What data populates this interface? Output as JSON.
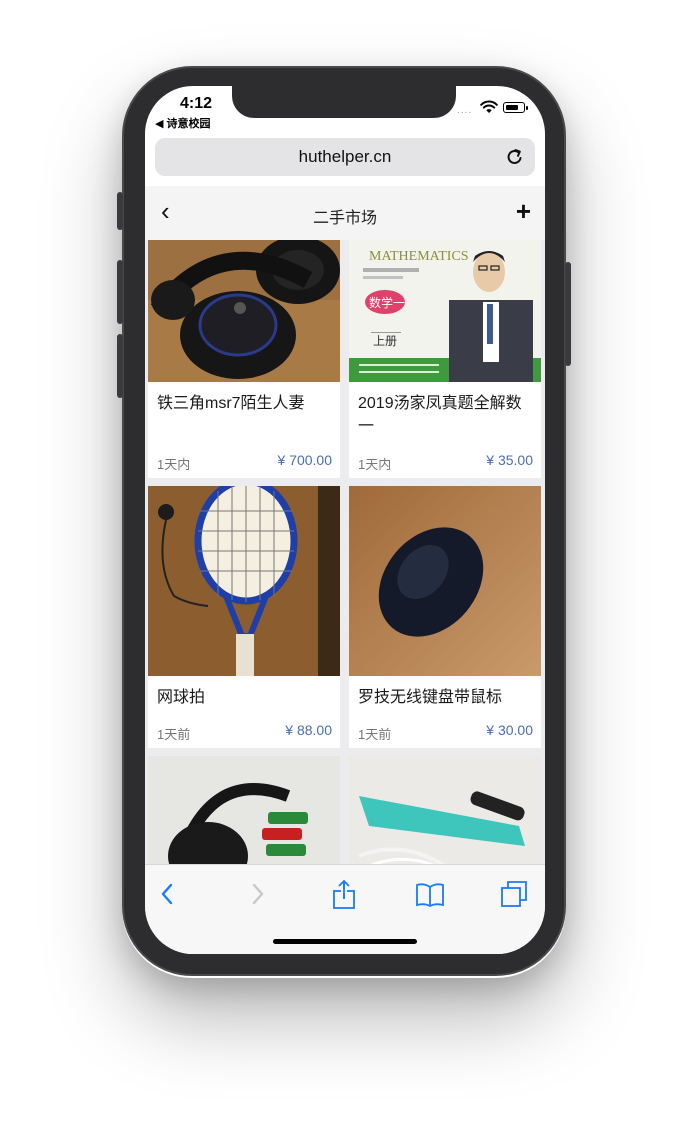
{
  "status_bar": {
    "time": "4:12",
    "back_app": "◀ 诗意校园",
    "signal": "....",
    "icons": [
      "wifi-icon",
      "battery-icon"
    ]
  },
  "browser": {
    "url": "huthelper.cn",
    "reload_icon": "reload-icon"
  },
  "nav": {
    "back_icon": "‹",
    "title": "二手市场",
    "add_icon": "+"
  },
  "products": [
    {
      "title": "铁三角msr7陌生人妻",
      "time": "1天内",
      "price": "¥ 700.00",
      "image": "black-headphones"
    },
    {
      "title": "2019汤家凤真题全解数一",
      "time": "1天内",
      "price": "¥ 35.00",
      "image": "mathematics-book-cover",
      "image_text": [
        "MATHEMATICS",
        "数学一",
        "上册"
      ]
    },
    {
      "title": "网球拍",
      "time": "1天前",
      "price": "¥ 88.00",
      "image": "tennis-racket"
    },
    {
      "title": "罗技无线键盘带鼠标",
      "time": "1天前",
      "price": "¥ 30.00",
      "image": "wireless-mouse"
    },
    {
      "title": "",
      "time": "",
      "price": "",
      "image": "headphones-and-batteries"
    },
    {
      "title": "",
      "time": "",
      "price": "",
      "image": "hair-curler"
    }
  ],
  "toolbar": {
    "icons": [
      "back-icon",
      "forward-icon",
      "share-icon",
      "bookmarks-icon",
      "tabs-icon"
    ]
  },
  "colors": {
    "price": "#4a6fae",
    "toolbar_accent": "#1a7cf5",
    "page_bg": "#ececee"
  }
}
